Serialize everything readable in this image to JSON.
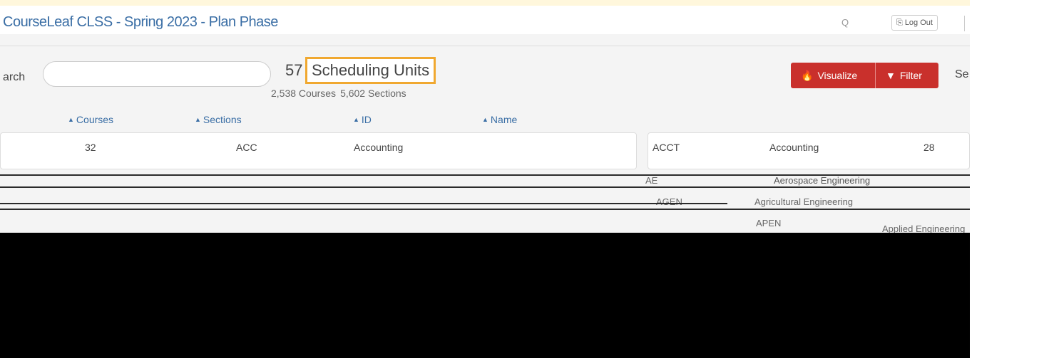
{
  "header": {
    "title": "CourseLeaf CLSS - Spring 2023 - Plan Phase",
    "user": "Q",
    "logout_label": "Log Out",
    "logout_icon": "log-out-icon"
  },
  "search": {
    "label": "arch",
    "value": "",
    "placeholder": ""
  },
  "summary": {
    "count": "57",
    "title": "Scheduling Units",
    "courses": "2,538 Courses",
    "sections": "5,602 Sections"
  },
  "actions": {
    "visualize_label": "Visualize",
    "visualize_icon": "fire-icon",
    "filter_label": "Filter",
    "filter_icon": "filter-icon",
    "search_right_label": "Se"
  },
  "sort_headers": [
    {
      "label": "Courses"
    },
    {
      "label": "Sections"
    },
    {
      "label": "ID"
    },
    {
      "label": "Name"
    }
  ],
  "units": [
    {
      "count": "32",
      "code": "ACC",
      "name": "Accounting"
    },
    {
      "code": "ACCT",
      "name": "Accounting",
      "count": "28"
    },
    {
      "code": "AE",
      "name": "Aerospace Engineering"
    },
    {
      "code": "AGEN",
      "name": "Agricultural Engineering"
    },
    {
      "code": "APEN",
      "name": "Applied Engineering"
    }
  ],
  "colors": {
    "accent_red": "#c9302c",
    "highlight_orange": "#f0a830",
    "link_blue": "#3a6ea5"
  }
}
